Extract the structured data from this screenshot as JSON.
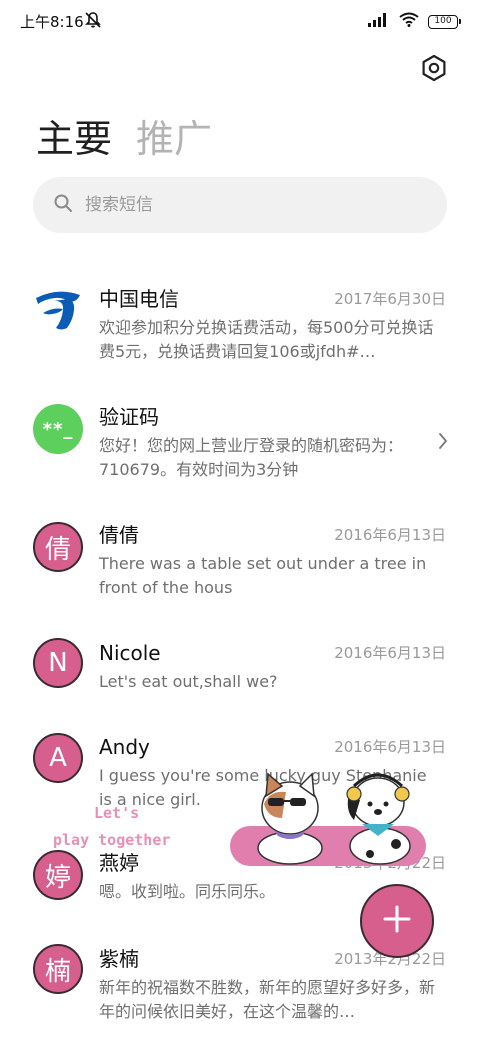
{
  "status_bar": {
    "time": "上午8:16",
    "battery": "100"
  },
  "tabs": [
    {
      "label": "主要",
      "active": true
    },
    {
      "label": "推广",
      "active": false
    }
  ],
  "search": {
    "placeholder": "搜索短信"
  },
  "conversations": [
    {
      "name": "中国电信",
      "date": "2017年6月30日",
      "preview": "欢迎参加积分兑换话费活动，每500分可兑换话费5元，兑换话费请回复106或jfdh#…",
      "avatar": "telecom-logo"
    },
    {
      "name": "验证码",
      "date": "",
      "preview": "您好！您的网上营业厅登录的随机密码为：710679。有效时间为3分钟",
      "avatar_text": "**_"
    },
    {
      "name": "倩倩",
      "date": "2016年6月13日",
      "preview": "There was a table set out under a tree in front of the hous",
      "avatar_text": "倩"
    },
    {
      "name": "Nicole",
      "date": "2016年6月13日",
      "preview": "Let's eat out,shall we?",
      "avatar_text": "N"
    },
    {
      "name": "Andy",
      "date": "2016年6月13日",
      "preview": "I guess you're some lucky guy Stephanie is a nice girl.",
      "avatar_text": "A"
    },
    {
      "name": "燕婷",
      "date": "2013年2月22日",
      "preview": "嗯。收到啦。同乐同乐。",
      "avatar_text": "婷"
    },
    {
      "name": "紫楠",
      "date": "2013年2月22日",
      "preview": "新年的祝福数不胜数，新年的愿望好多好多，新年的问候依旧美好，在这个温馨的…",
      "avatar_text": "楠"
    }
  ],
  "sticker": {
    "line1": "Let's",
    "line2": "play together"
  },
  "colors": {
    "accent_pink": "#d65f8e",
    "verify_green": "#5ccf5c",
    "telecom_blue": "#0b5cb5"
  }
}
